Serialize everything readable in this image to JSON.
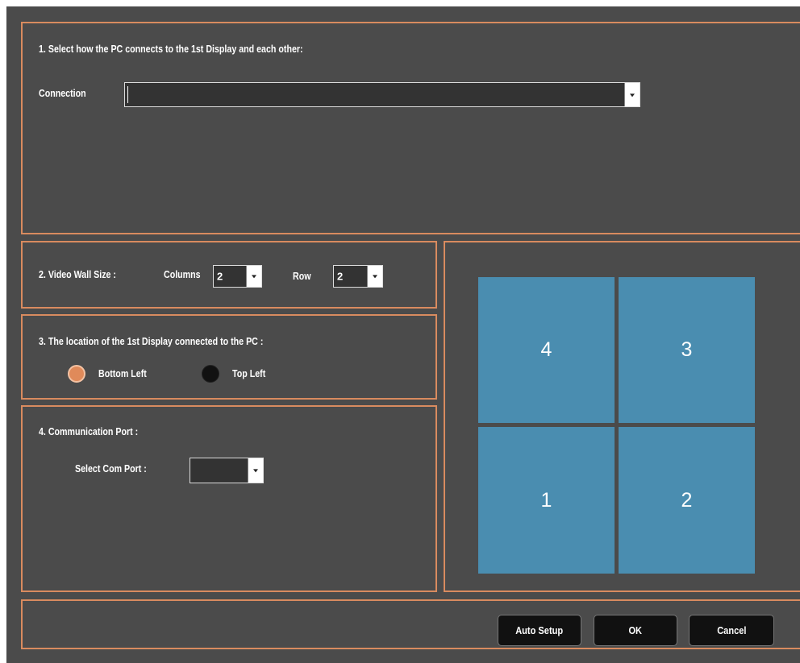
{
  "section1": {
    "title": "1. Select how the PC connects to the 1st Display and each other:",
    "connection_label": "Connection",
    "connection_value": ""
  },
  "section2": {
    "title": "2. Video Wall Size :",
    "columns_label": "Columns",
    "columns_value": "2",
    "row_label": "Row",
    "row_value": "2"
  },
  "section3": {
    "title": "3. The location of the 1st Display connected to the PC :",
    "options": [
      {
        "label": "Bottom Left",
        "selected": true
      },
      {
        "label": "Top Left",
        "selected": false
      }
    ]
  },
  "section4": {
    "title": "4. Communication Port :",
    "port_label": "Select Com Port :",
    "port_value": ""
  },
  "preview": {
    "tiles": [
      "4",
      "3",
      "1",
      "2"
    ],
    "tile_color": "#4a8db0"
  },
  "buttons": {
    "auto_setup": "Auto Setup",
    "ok": "OK",
    "cancel": "Cancel"
  },
  "colors": {
    "background": "#4b4b4b",
    "border": "#d98b5f",
    "radio_selected": "#e08a5a",
    "radio_unselected": "#111111"
  }
}
